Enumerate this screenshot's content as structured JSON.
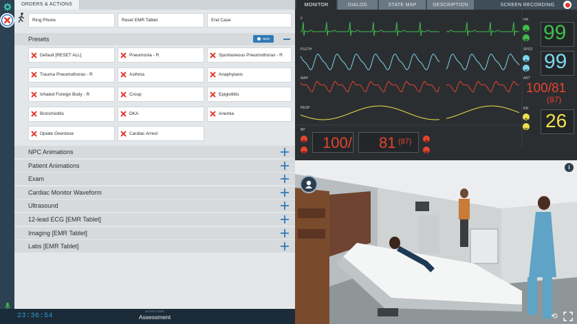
{
  "left_tabs": [
    "ORDERS & ACTIONS"
  ],
  "actions": {
    "ring": "Ring Phone",
    "reset_tablet": "Reset EMR Tablet",
    "end_case": "End Case"
  },
  "presets": {
    "title": "Presets",
    "new_label": "NEW",
    "items": [
      "Default [RESET ALL]",
      "Pneumonia - R",
      "Spontaneous Pneumothorax - R",
      "Trauma Pneumothorax - R",
      "Asthma",
      "Anaphylaxis",
      "Inhaled Foreign Body - R",
      "Croup",
      "Epiglottitis",
      "Bronchiolitis",
      "DKA",
      "Anemia",
      "Opiate Overdose",
      "Cardiac Arrest"
    ]
  },
  "sections": [
    "NPC Animations",
    "Patient Animations",
    "Exam",
    "Cardiac Monitor Waveform",
    "Ultrasound",
    "12-lead ECG [EMR Tablet]",
    "Imaging [EMR Tablet]",
    "Labs [EMR Tablet]"
  ],
  "status": {
    "timer": "23:36:54",
    "state_label": "ACTIVE STATE",
    "state_value": "Assessment"
  },
  "right_tabs": {
    "monitor": "MONITOR",
    "dialog": "DIALOG",
    "state_map": "STATE MAP",
    "description": "DESCRIPTION",
    "recording": "SCREEN RECORDING"
  },
  "monitor": {
    "wave_labels": [
      "II",
      "PLETH",
      "MAP",
      "RESP",
      "BP"
    ],
    "hr": {
      "label": "HR",
      "value": "99",
      "color": "#3fbf4a"
    },
    "spo2": {
      "label": "SPO2",
      "value": "99",
      "color": "#7fd6ec"
    },
    "art": {
      "label": "ART",
      "value": "100/81",
      "sub": "(87)",
      "color": "#e4442f"
    },
    "rr": {
      "label": "RR",
      "value": "26",
      "color": "#efe24f"
    },
    "bp": {
      "sys": "100/",
      "dia": "81",
      "map": "(87)",
      "color": "#e4442f"
    }
  },
  "colors": {
    "accent": "#2f79b8",
    "red": "#e23a2e"
  }
}
